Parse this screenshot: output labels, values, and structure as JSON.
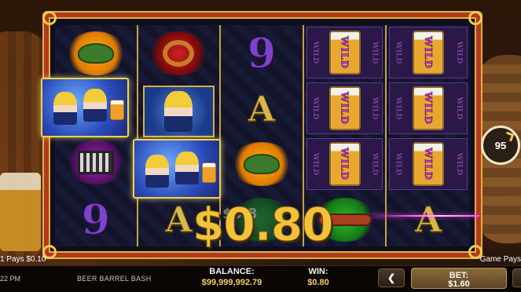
{
  "game": {
    "title": "BEER BARREL BASH",
    "time": "22 PM"
  },
  "reels": {
    "wild_label": "WILD",
    "nine": "9",
    "ace": "A"
  },
  "win_overlay": {
    "amount": "$0.80",
    "faded": "$0.8"
  },
  "spin_counter": {
    "value": "95",
    "icon": "refresh-arrow-icon"
  },
  "pays": {
    "left": "1 Pays $0.10",
    "right": "Game Pays"
  },
  "bottom_bar": {
    "balance_label": "BALANCE:",
    "balance_value": "$99,999,992.79",
    "win_label": "WIN:",
    "win_value": "$0.80",
    "bet_label": "BET:",
    "bet_value": "$1.60",
    "prev_icon": "chevron-left-icon"
  },
  "colors": {
    "frame": "#b03a1e",
    "gold": "#f2c23a",
    "laser": "#ff4af2",
    "wild_purple": "#c83ad8"
  }
}
